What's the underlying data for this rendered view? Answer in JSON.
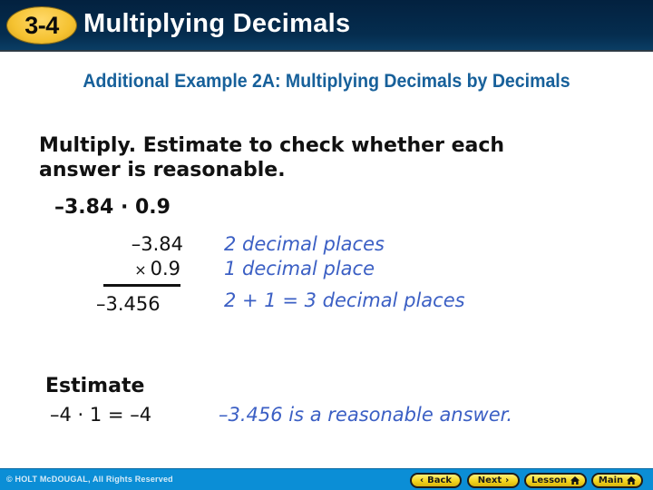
{
  "header": {
    "badge": "3-4",
    "title": "Multiplying Decimals"
  },
  "example": {
    "title": "Additional Example 2A: Multiplying Decimals by Decimals"
  },
  "instruction": "Multiply. Estimate to check whether each answer is reasonable.",
  "problem": "–3.84 · 0.9",
  "calculation": {
    "multiplicand": "–3.84",
    "times_symbol": "×",
    "multiplier": "0.9",
    "product": "–3.456"
  },
  "notes": [
    "2 decimal places",
    "1 decimal place",
    "2 + 1 = 3 decimal places"
  ],
  "estimate": {
    "label": "Estimate",
    "expression": "–4 · 1 = –4",
    "conclusion": "–3.456 is a reasonable answer."
  },
  "footer": {
    "copyright": "© HOLT McDOUGAL, All Rights Reserved",
    "buttons": [
      {
        "label": "Back",
        "icon": "chevron-left-icon",
        "glyph": "‹"
      },
      {
        "label": "Next",
        "icon": "chevron-right-icon",
        "glyph": "›"
      },
      {
        "label": "Lesson",
        "icon": "home-icon"
      },
      {
        "label": "Main",
        "icon": "home-icon"
      }
    ]
  },
  "colors": {
    "header_bg": "#03213f",
    "badge": "#f5c231",
    "example_title": "#17609a",
    "notes": "#3b5fc4",
    "footer_bg": "#0b8ed6",
    "nav_button": "#f4d61e"
  }
}
